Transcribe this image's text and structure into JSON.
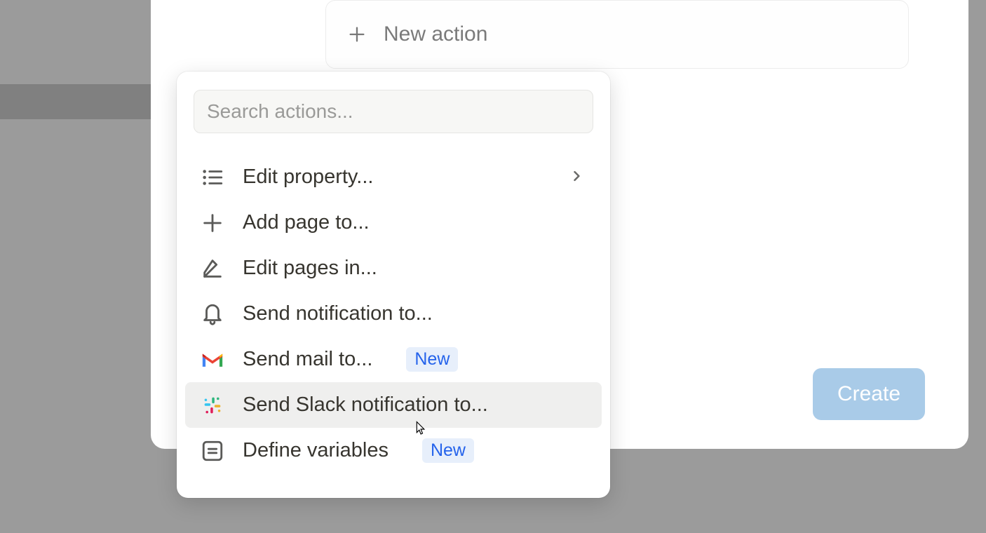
{
  "new_action": {
    "label": "New action"
  },
  "search": {
    "placeholder": "Search actions..."
  },
  "actions": [
    {
      "icon": "list",
      "label": "Edit property...",
      "has_chevron": true
    },
    {
      "icon": "plus",
      "label": "Add page to..."
    },
    {
      "icon": "edit",
      "label": "Edit pages in..."
    },
    {
      "icon": "bell",
      "label": "Send notification to..."
    },
    {
      "icon": "gmail",
      "label": "Send mail to...",
      "badge": "New"
    },
    {
      "icon": "slack",
      "label": "Send Slack notification to...",
      "hovered": true
    },
    {
      "icon": "variables",
      "label": "Define variables",
      "badge": "New"
    }
  ],
  "create_button": {
    "label": "Create"
  }
}
